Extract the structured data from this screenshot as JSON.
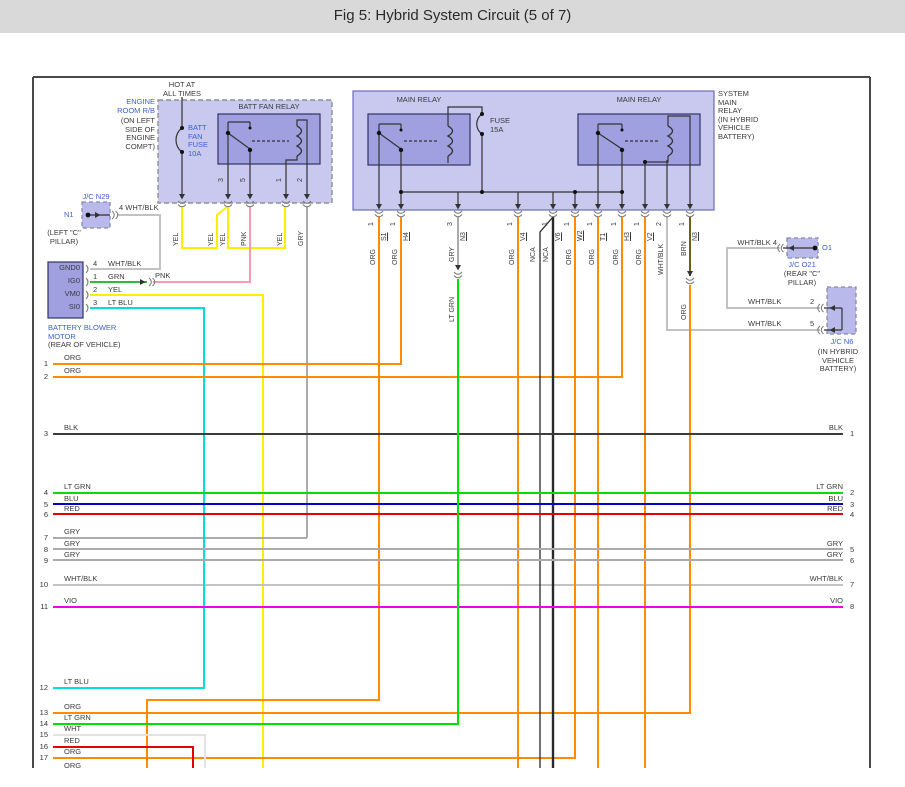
{
  "header": {
    "title": "Fig 5: Hybrid System Circuit (5 of 7)"
  },
  "engine_room": {
    "hot": "HOT AT\nALL TIMES",
    "label": "ENGINE\nROOM R/B",
    "sub": "(ON LEFT\nSIDE OF\nENGINE\nCOMPT)",
    "relay_title": "BATT FAN RELAY",
    "fuse_label": "BATT\nFAN\nFUSE\n10A",
    "pin_nums": [
      "3",
      "5",
      "1",
      "2"
    ],
    "wire_labels": [
      "YEL",
      "YEL",
      "YEL",
      "PNK",
      "YEL",
      "GRY"
    ]
  },
  "jc_n29": {
    "title": "J/C N29",
    "pin": "N1",
    "loc": "(LEFT \"C\"\nPILLAR)",
    "wire": "4  WHT/BLK"
  },
  "blower": {
    "pins": [
      "GND0",
      "IG0",
      "VM0",
      "SI0"
    ],
    "pin_nums": [
      "4",
      "1",
      "2",
      "3"
    ],
    "wires": [
      "WHT/BLK",
      "GRN",
      "YEL",
      "LT BLU"
    ],
    "pnk": "PNK",
    "title": "BATTERY BLOWER\nMOTOR",
    "loc": "(REAR OF VEHICLE)"
  },
  "main_box": {
    "relay_left": "MAIN RELAY",
    "relay_right": "MAIN RELAY",
    "fuse": "FUSE\n15A",
    "note": "SYSTEM\nMAIN\nRELAY\n(IN HYBRID\nVEHICLE\nBATTERY)",
    "pins": [
      {
        "num": "1",
        "id": "S1",
        "color": "ORG"
      },
      {
        "num": "1",
        "id": "H4",
        "color": "ORG"
      },
      {
        "num": "3",
        "id": "N3",
        "color": "GRY"
      },
      {
        "num": "1",
        "id": "V4",
        "color": "ORG"
      },
      {
        "num": "1",
        "id": "V6",
        "color": "NCA",
        "color2": "NCA"
      },
      {
        "num": "1",
        "id": "W2",
        "color": "ORG"
      },
      {
        "num": "1",
        "id": "T1",
        "color": "ORG"
      },
      {
        "num": "1",
        "id": "H3",
        "color": "ORG"
      },
      {
        "num": "1",
        "id": "V2",
        "color": "ORG"
      },
      {
        "num": "2",
        "id": "",
        "color": "WHT/BLK"
      },
      {
        "num": "1",
        "id": "N3",
        "color": "BRN"
      }
    ],
    "n3_left_lower": "LT GRN",
    "n3_right_lower": "ORG"
  },
  "jc_o21": {
    "wire": "WHT/BLK 4",
    "title": "J/C O21",
    "loc": "(REAR \"C\"\nPILLAR)",
    "pin": "O1"
  },
  "jc_n6": {
    "title": "J/C N6",
    "loc": "(IN HYBRID\nVEHICLE\nBATTERY)",
    "rows": [
      {
        "label": "WHT/BLK",
        "num": "2"
      },
      {
        "label": "WHT/BLK",
        "num": "5"
      }
    ]
  },
  "left_wires": [
    {
      "n": "1",
      "c": "ORG"
    },
    {
      "n": "2",
      "c": "ORG"
    },
    {
      "n": "3",
      "c": "BLK"
    },
    {
      "n": "4",
      "c": "LT GRN"
    },
    {
      "n": "5",
      "c": "BLU"
    },
    {
      "n": "6",
      "c": "RED"
    },
    {
      "n": "7",
      "c": "GRY"
    },
    {
      "n": "8",
      "c": "GRY"
    },
    {
      "n": "9",
      "c": "GRY"
    },
    {
      "n": "10",
      "c": "WHT/BLK"
    },
    {
      "n": "11",
      "c": "VIO"
    },
    {
      "n": "12",
      "c": "LT BLU"
    },
    {
      "n": "13",
      "c": "ORG"
    },
    {
      "n": "14",
      "c": "LT GRN"
    },
    {
      "n": "15",
      "c": "WHT"
    },
    {
      "n": "16",
      "c": "RED"
    },
    {
      "n": "17",
      "c": "ORG"
    },
    {
      "n": "",
      "c": "ORG"
    }
  ],
  "right_wires": [
    {
      "n": "1",
      "c": "BLK"
    },
    {
      "n": "2",
      "c": "LT GRN"
    },
    {
      "n": "3",
      "c": "BLU"
    },
    {
      "n": "4",
      "c": "RED"
    },
    {
      "n": "5",
      "c": "GRY"
    },
    {
      "n": "6",
      "c": "GRY"
    },
    {
      "n": "7",
      "c": "WHT/BLK"
    },
    {
      "n": "8",
      "c": "VIO"
    }
  ],
  "colors": {
    "ORG": "#ff8c00",
    "YEL": "#ffee00",
    "PNK": "#ff99b3",
    "GRY": "#ababab",
    "BLK": "#3c3c3c",
    "LT GRN": "#00e000",
    "GRN": "#33bb33",
    "BLU": "#0000d0",
    "RED": "#e80000",
    "WHT": "#e2e2e2",
    "WHT/BLK": "#c2c2c2",
    "VIO": "#ee00ee",
    "LT BLU": "#00dede",
    "BRN": "#6b6114",
    "NCA": "#2a2a2a",
    "box_light": "#c9c9ef",
    "box_dark": "#a0a0e0",
    "jc_fill": "#b9b9ec",
    "link_blue": "#3b5fd0",
    "titlebar": "#d9d9d9"
  }
}
